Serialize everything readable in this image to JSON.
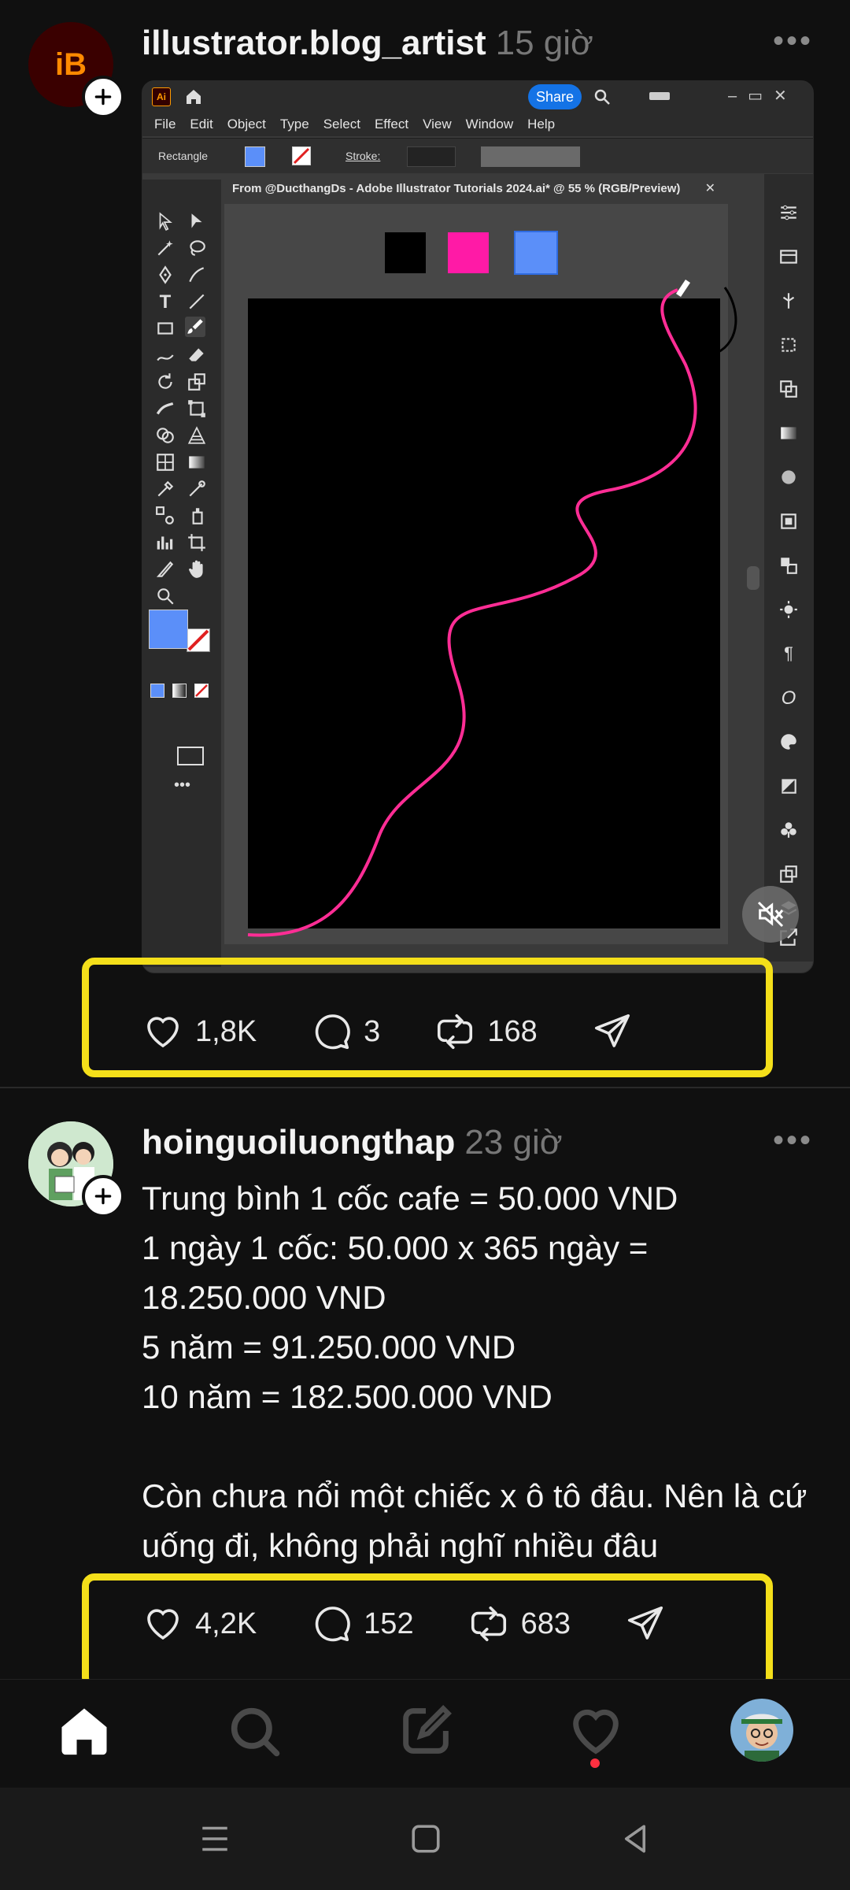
{
  "post1": {
    "avatar_text": "iB",
    "username": "illustrator.blog_artist",
    "time": "15 giờ",
    "app": {
      "logo": "Ai",
      "share_label": "Share",
      "menu": [
        "File",
        "Edit",
        "Object",
        "Type",
        "Select",
        "Effect",
        "View",
        "Window",
        "Help"
      ],
      "control_tool_name": "Rectangle",
      "stroke_label": "Stroke:",
      "document_tab": "From @DucthangDs - Adobe Illustrator Tutorials 2024.ai* @ 55 % (RGB/Preview)",
      "swatch_colors": [
        "#000000",
        "#ff1aa6",
        "#5b8ff9"
      ],
      "fill_color": "#5b8ff9",
      "stroke_color": "#ff2d95"
    },
    "likes": "1,8K",
    "comments": "3",
    "reposts": "168"
  },
  "post2": {
    "username": "hoinguoiluongthap",
    "time": "23 giờ",
    "text": "Trung bình 1 cốc cafe = 50.000 VND\n1 ngày 1 cốc: 50.000 x 365 ngày = 18.250.000 VND\n5 năm = 91.250.000 VND\n10 năm = 182.500.000 VND\n\nCòn chưa nổi một chiếc x ô tô đâu. Nên là cứ uống đi, không phải nghĩ nhiều đâu",
    "likes": "4,2K",
    "comments": "152",
    "reposts": "683"
  },
  "colors": {
    "background": "#101010",
    "highlight": "#f4df1a",
    "notification": "#ff3040",
    "muted_text": "#777777"
  },
  "icons": {
    "like": "heart-icon",
    "comment": "comment-bubble-icon",
    "repost": "repost-icon",
    "share": "send-icon",
    "nav": [
      "home-icon",
      "search-icon",
      "compose-icon",
      "activity-heart-icon",
      "profile-avatar"
    ]
  }
}
